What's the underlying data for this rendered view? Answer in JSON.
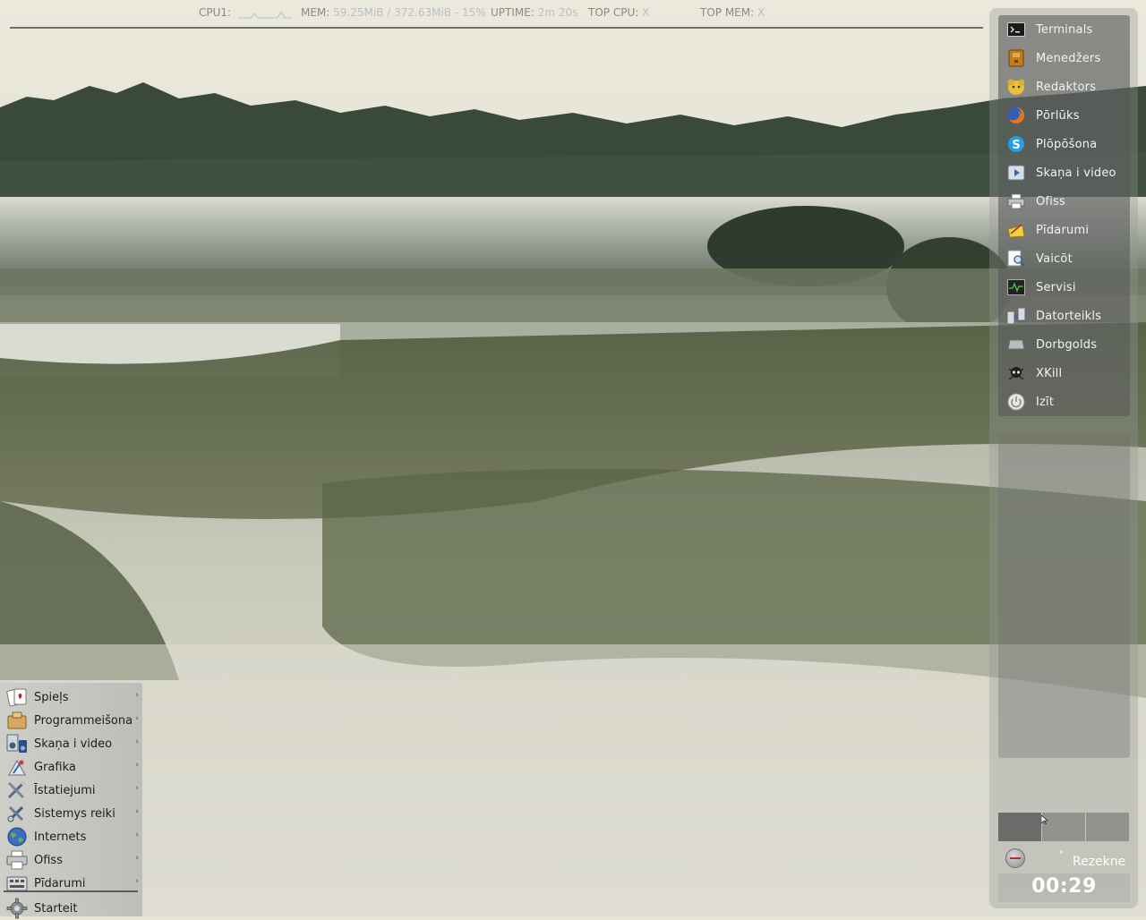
{
  "conky": {
    "cpu_label": "CPU1:",
    "mem_label": "MEM:",
    "mem_value": "59.25MiB / 372.63MiB - 15%",
    "uptime_label": "UPTIME:",
    "uptime_value": "2m 20s",
    "top_cpu_label": "TOP CPU:",
    "top_cpu_value": "X",
    "top_mem_label": "TOP MEM:",
    "top_mem_value": "X"
  },
  "launcher": {
    "items": [
      {
        "label": "Terminals",
        "icon": "terminal-icon"
      },
      {
        "label": "Menedžers",
        "icon": "file-manager-icon"
      },
      {
        "label": "Redaktors",
        "icon": "text-editor-icon"
      },
      {
        "label": "Pōrlūks",
        "icon": "firefox-icon"
      },
      {
        "label": "Plōpōšona",
        "icon": "skype-icon"
      },
      {
        "label": "Skaņa i video",
        "icon": "media-player-icon"
      },
      {
        "label": "Ofiss",
        "icon": "printer-icon"
      },
      {
        "label": "Pīdarumi",
        "icon": "accessories-icon"
      },
      {
        "label": "Vaicōt",
        "icon": "search-icon"
      },
      {
        "label": "Servisi",
        "icon": "system-monitor-icon"
      },
      {
        "label": "Datorteikls",
        "icon": "network-icon"
      },
      {
        "label": "Dorbgolds",
        "icon": "desktop-icon"
      },
      {
        "label": "XKill",
        "icon": "skull-icon"
      },
      {
        "label": "Izīt",
        "icon": "power-icon"
      }
    ]
  },
  "tray": {
    "degree": "°",
    "layout": "Rezekne"
  },
  "clock": {
    "time": "00:29"
  },
  "menu": {
    "items": [
      {
        "label": "Spieļs",
        "icon": "games-icon",
        "submenu": true
      },
      {
        "label": "Programmeišona",
        "icon": "development-icon",
        "submenu": true
      },
      {
        "label": "Skaņa i video",
        "icon": "multimedia-icon",
        "submenu": true
      },
      {
        "label": "Grafika",
        "icon": "graphics-icon",
        "submenu": true
      },
      {
        "label": "Īstatiejumi",
        "icon": "settings-icon",
        "submenu": true
      },
      {
        "label": "Sistemys reiki",
        "icon": "system-tools-icon",
        "submenu": true
      },
      {
        "label": "Internets",
        "icon": "internet-icon",
        "submenu": true
      },
      {
        "label": "Ofiss",
        "icon": "office-icon",
        "submenu": true
      },
      {
        "label": "Pīdarumi",
        "icon": "accessories-icon",
        "submenu": true
      }
    ],
    "start_label": "Starteit",
    "start_icon": "gear-icon",
    "arrow": "›"
  },
  "colors": {
    "launcher_text": "#f2f2f2",
    "menu_text": "#1d1d1d",
    "clock_text": "#ffffff"
  }
}
